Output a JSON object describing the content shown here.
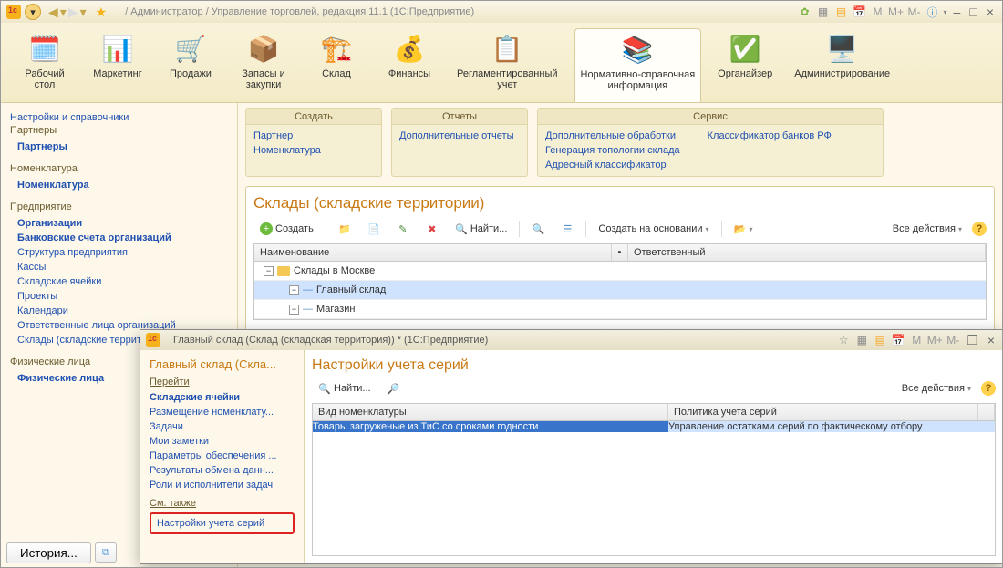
{
  "app": {
    "title": " / Администратор / Управление торговлей, редакция 11.1  (1С:Предприятие)",
    "mem_buttons": [
      "M",
      "M+",
      "M-"
    ]
  },
  "sections": [
    {
      "label": "Рабочий\nстол",
      "icon": "🗓️"
    },
    {
      "label": "Маркетинг",
      "icon": "📊"
    },
    {
      "label": "Продажи",
      "icon": "🛒"
    },
    {
      "label": "Запасы и\nзакупки",
      "icon": "📦"
    },
    {
      "label": "Склад",
      "icon": "🏗️"
    },
    {
      "label": "Финансы",
      "icon": "💰"
    },
    {
      "label": "Регламентированный\nучет",
      "icon": "📋"
    },
    {
      "label": "Нормативно-справочная\nинформация",
      "icon": "📚",
      "active": true
    },
    {
      "label": "Органайзер",
      "icon": "✅"
    },
    {
      "label": "Администрирование",
      "icon": "🖥️"
    }
  ],
  "leftnav": {
    "top_link": "Настройки и справочники",
    "groups": [
      {
        "title": "Партнеры",
        "items": [
          {
            "label": "Партнеры",
            "bold": true
          }
        ]
      },
      {
        "title": "Номенклатура",
        "items": [
          {
            "label": "Номенклатура",
            "bold": true
          }
        ]
      },
      {
        "title": "Предприятие",
        "items": [
          {
            "label": "Организации",
            "bold": true
          },
          {
            "label": "Банковские счета организаций",
            "bold": true
          },
          {
            "label": "Структура предприятия"
          },
          {
            "label": "Кассы"
          },
          {
            "label": "Складские ячейки"
          },
          {
            "label": "Проекты"
          },
          {
            "label": "Календари"
          },
          {
            "label": "Ответственные лица организаций"
          },
          {
            "label": "Склады (складские территории)"
          }
        ]
      },
      {
        "title": "Физические лица",
        "items": [
          {
            "label": "Физические лица",
            "bold": true
          }
        ]
      }
    ],
    "history_btn": "История..."
  },
  "cmdpanel": {
    "create": {
      "title": "Создать",
      "items": [
        "Партнер",
        "Номенклатура"
      ]
    },
    "reports": {
      "title": "Отчеты",
      "items": [
        "Дополнительные отчеты"
      ]
    },
    "service": {
      "title": "Сервис",
      "col1": [
        "Дополнительные обработки",
        "Генерация топологии склада",
        "Адресный классификатор"
      ],
      "col2": [
        "Классификатор банков РФ"
      ]
    }
  },
  "content": {
    "title": "Склады (складские территории)",
    "toolbar": {
      "create": "Создать",
      "find": "Найти...",
      "create_based": "Создать на основании",
      "all_actions": "Все действия"
    },
    "grid": {
      "col1": "Наименование",
      "col2": "Ответственный",
      "rows": [
        {
          "level": 0,
          "exp": "-",
          "folder": true,
          "label": "Склады в Москве"
        },
        {
          "level": 1,
          "exp": "-",
          "folder": false,
          "label": "Главный склад",
          "sel": true
        },
        {
          "level": 1,
          "exp": "-",
          "folder": false,
          "label": "Магазин"
        }
      ]
    }
  },
  "child": {
    "title": "Главный склад (Склад (складская территория)) *  (1С:Предприятие)",
    "nav": {
      "header": "Главный склад (Скла...",
      "go": "Перейти",
      "items": [
        {
          "label": "Складские ячейки",
          "bold": true
        },
        {
          "label": "Размещение номенклату..."
        },
        {
          "label": "Задачи"
        },
        {
          "label": "Мои заметки"
        },
        {
          "label": "Параметры обеспечения ..."
        },
        {
          "label": "Результаты обмена данн..."
        },
        {
          "label": "Роли и исполнители задач"
        }
      ],
      "see_also": "См. также",
      "highlight": "Настройки учета серий"
    },
    "main": {
      "title": "Настройки учета серий",
      "toolbar": {
        "find": "Найти...",
        "all_actions": "Все действия"
      },
      "grid": {
        "col1": "Вид номенклатуры",
        "col2": "Политика учета серий",
        "row": {
          "c1": "Товары загруженые из ТиС со сроками годности",
          "c2": "Управление остатками серий по фактическому отбору"
        }
      }
    }
  }
}
